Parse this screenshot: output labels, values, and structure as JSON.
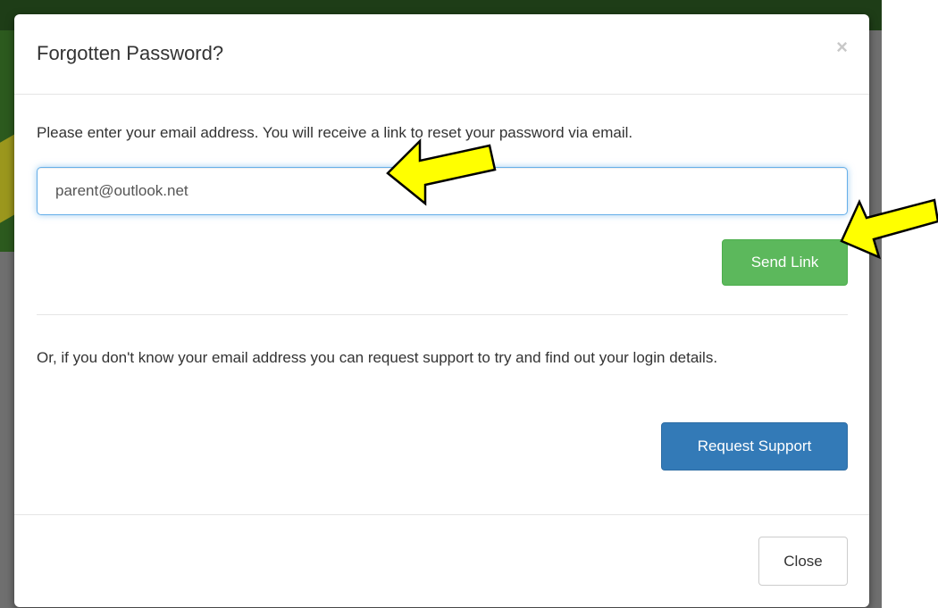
{
  "modal": {
    "title": "Forgotten Password?",
    "close_icon": "×",
    "instructions": "Please enter your email address. You will receive a link to reset your password via email.",
    "email": {
      "value": "parent@outlook.net",
      "placeholder": ""
    },
    "send_label": "Send Link",
    "support_text": "Or, if you don't know your email address you can request support to try and find out your login details.",
    "support_label": "Request Support",
    "footer_close_label": "Close"
  },
  "annotations": {
    "arrow_color": "#ffff00",
    "arrow_outline": "#000000",
    "icon": "arrow-icon"
  },
  "colors": {
    "send_button": "#5cb85c",
    "support_button": "#337ab7",
    "input_focus": "#66afe9",
    "backdrop": "#6f6f6f",
    "page_header": "#1e3d17"
  }
}
